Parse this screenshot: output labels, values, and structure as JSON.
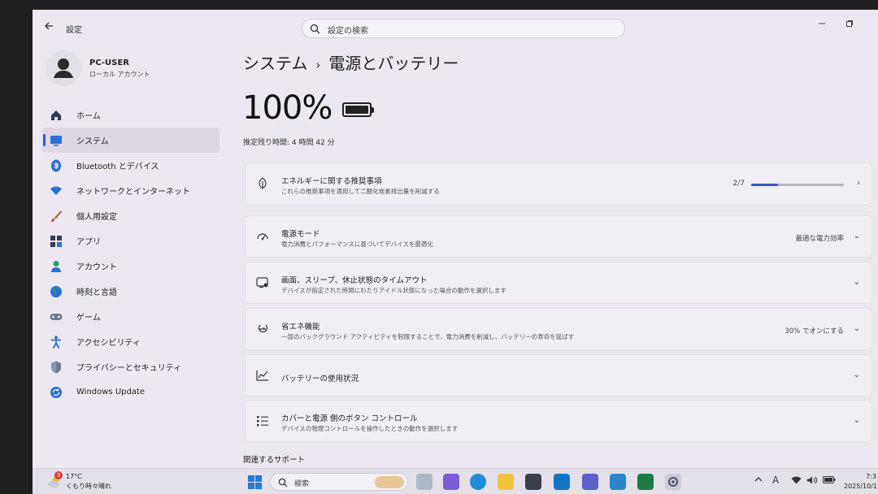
{
  "window": {
    "title": "設定",
    "search_placeholder": "設定の検索"
  },
  "profile": {
    "name": "PC-USER",
    "account_type": "ローカル アカウント"
  },
  "sidebar": {
    "items": [
      {
        "label": "ホーム",
        "icon": "home-icon"
      },
      {
        "label": "システム",
        "icon": "system-icon",
        "selected": true
      },
      {
        "label": "Bluetooth とデバイス",
        "icon": "bluetooth-icon"
      },
      {
        "label": "ネットワークとインターネット",
        "icon": "network-icon"
      },
      {
        "label": "個人用設定",
        "icon": "brush-icon"
      },
      {
        "label": "アプリ",
        "icon": "apps-icon"
      },
      {
        "label": "アカウント",
        "icon": "account-icon"
      },
      {
        "label": "時刻と言語",
        "icon": "globe-icon"
      },
      {
        "label": "ゲーム",
        "icon": "gamepad-icon"
      },
      {
        "label": "アクセシビリティ",
        "icon": "accessibility-icon"
      },
      {
        "label": "プライバシーとセキュリティ",
        "icon": "shield-icon"
      },
      {
        "label": "Windows Update",
        "icon": "update-icon"
      }
    ]
  },
  "main": {
    "breadcrumb_parent": "システム",
    "breadcrumb_separator": "›",
    "breadcrumb_current": "電源とバッテリー",
    "battery_percent": "100%",
    "battery_level": 1.0,
    "remaining_time": "推定残り時間: 4 時間 42 分",
    "cards": [
      {
        "title": "エネルギーに関する推奨事項",
        "subtitle": "これらの推奨事項を適用して二酸化炭素排出量を削減する",
        "progress_text": "2/7",
        "progress_fraction": 0.2857,
        "icon": "leaf-icon",
        "chevron": "›"
      },
      {
        "title": "電源モード",
        "subtitle": "電力消費とパフォーマンスに基づいてデバイスを最適化",
        "value": "最適な電力効率",
        "icon": "power-mode-icon",
        "chevron": "⌄"
      },
      {
        "title": "画面、スリープ、休止状態のタイムアウト",
        "subtitle": "デバイスが指定された時間にわたりアイドル状態になった場合の動作を選択します",
        "icon": "screen-sleep-icon",
        "chevron": "⌄"
      },
      {
        "title": "省エネ機能",
        "subtitle": "一部のバックグラウンド アクティビティを制限することで、電力消費を削減し、バッテリーの寿命を延ばす",
        "value": "30% でオンにする",
        "icon": "energy-saver-icon",
        "chevron": "⌄"
      },
      {
        "title": "バッテリーの使用状況",
        "icon": "usage-chart-icon",
        "chevron": "⌄"
      },
      {
        "title": "カバーと電源 側のボタン コントロール",
        "subtitle": "デバイスの物理コントロールを操作したときの動作を選択します",
        "icon": "controls-icon",
        "chevron": "⌄"
      }
    ],
    "related_heading": "関連するサポート"
  },
  "taskbar": {
    "weather_temp": "17°C",
    "weather_desc": "くもり時々晴れ",
    "weather_badge": "3",
    "search_placeholder": "検索",
    "clock_time": "7:3",
    "clock_date": "2025/10/1",
    "tray_ime": "A",
    "colors": {
      "accent": "#3a56c8"
    }
  }
}
